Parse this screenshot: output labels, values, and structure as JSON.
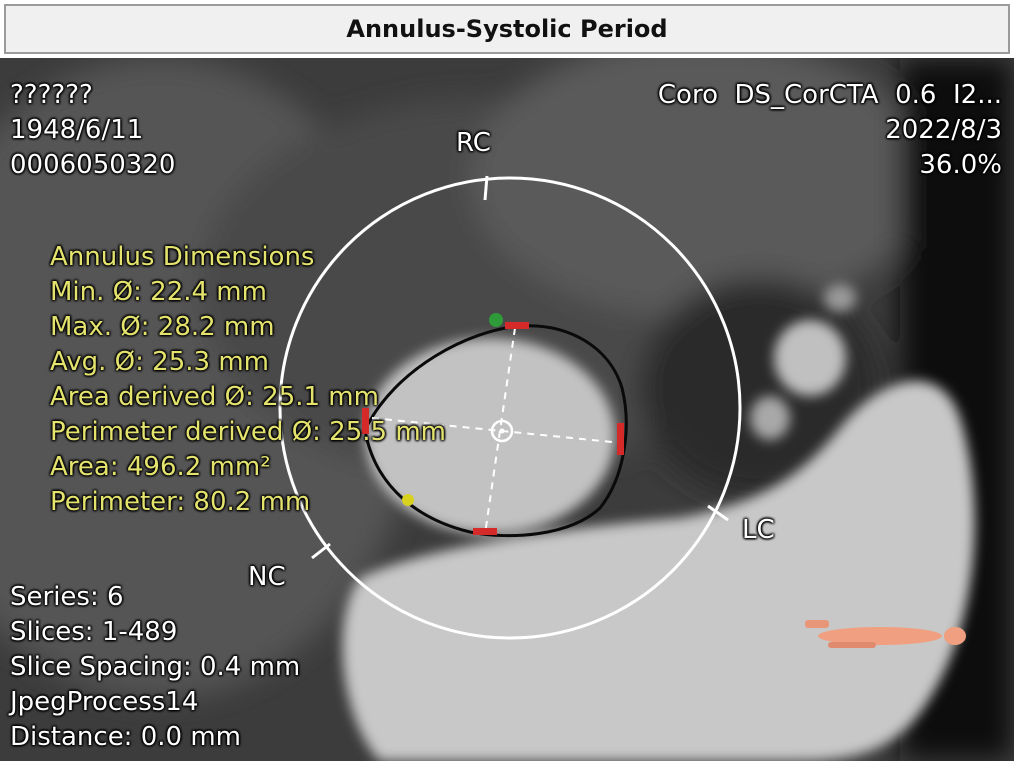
{
  "header": {
    "title": "Annulus-Systolic Period"
  },
  "patient": {
    "name": "??????",
    "dob": "1948/6/11",
    "id": "0006050320"
  },
  "study": {
    "description": "Coro  DS_CorCTA  0.6  I2...",
    "date": "2022/8/3",
    "phase": "36.0%"
  },
  "cusp_labels": {
    "rc": "RC",
    "lc": "LC",
    "nc": "NC"
  },
  "measurements": {
    "title": "Annulus Dimensions",
    "min": "Min. Ø: 22.4 mm",
    "max": "Max. Ø: 28.2 mm",
    "avg": "Avg. Ø: 25.3 mm",
    "area_derived": "Area derived Ø: 25.1 mm",
    "perimeter_derived": "Perimeter derived Ø: 25.5 mm",
    "area": "Area: 496.2 mm²",
    "perimeter": "Perimeter: 80.2 mm"
  },
  "series_info": {
    "series": "Series: 6",
    "slices": "Slices: 1-489",
    "slice_spacing": "Slice Spacing: 0.4 mm",
    "compression": "JpegProcess14",
    "distance": "Distance: 0.0 mm"
  },
  "colors": {
    "measurement_text": "#e4e36e",
    "overlay_text": "#ffffff",
    "marker_red": "#d42a2a",
    "marker_green": "#2f9a3a",
    "marker_yellow": "#d8d21f",
    "orientation_figure": "#f0a080"
  }
}
